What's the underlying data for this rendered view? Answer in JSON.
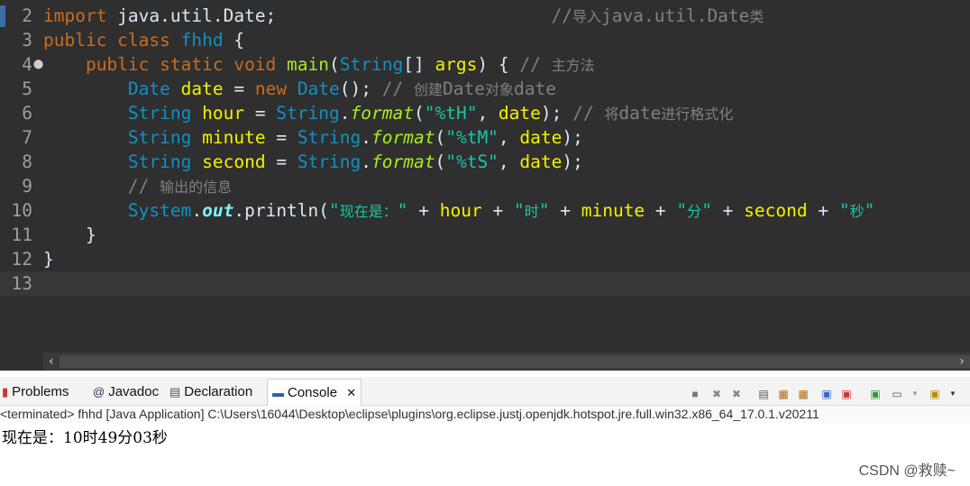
{
  "editor": {
    "lines": [
      {
        "n": "2",
        "fold": "",
        "current": false,
        "tokens": [
          {
            "t": "kw",
            "v": "import"
          },
          {
            "t": "",
            "v": " java.util.Date;                          "
          },
          {
            "t": "cm",
            "v": "//导入java.util.Date类"
          }
        ]
      },
      {
        "n": "3",
        "fold": "",
        "current": false,
        "tokens": [
          {
            "t": "kw",
            "v": "public class "
          },
          {
            "t": "typ",
            "v": "fhhd"
          },
          {
            "t": "",
            "v": " {"
          }
        ]
      },
      {
        "n": "4",
        "fold": "⬤",
        "current": false,
        "tokens": [
          {
            "t": "",
            "v": "    "
          },
          {
            "t": "kw",
            "v": "public static void "
          },
          {
            "t": "meth",
            "v": "main"
          },
          {
            "t": "",
            "v": "("
          },
          {
            "t": "typ",
            "v": "String"
          },
          {
            "t": "",
            "v": "[] "
          },
          {
            "t": "var",
            "v": "args"
          },
          {
            "t": "",
            "v": ") { "
          },
          {
            "t": "cm",
            "v": "// 主方法"
          }
        ]
      },
      {
        "n": "5",
        "fold": "",
        "current": false,
        "tokens": [
          {
            "t": "",
            "v": "        "
          },
          {
            "t": "typ",
            "v": "Date"
          },
          {
            "t": "",
            "v": " "
          },
          {
            "t": "var",
            "v": "date"
          },
          {
            "t": "",
            "v": " = "
          },
          {
            "t": "kw",
            "v": "new "
          },
          {
            "t": "typ",
            "v": "Date"
          },
          {
            "t": "",
            "v": "(); "
          },
          {
            "t": "cm",
            "v": "// 创建Date对象date"
          }
        ]
      },
      {
        "n": "6",
        "fold": "",
        "current": false,
        "tokens": [
          {
            "t": "",
            "v": "        "
          },
          {
            "t": "typ",
            "v": "String"
          },
          {
            "t": "",
            "v": " "
          },
          {
            "t": "var",
            "v": "hour"
          },
          {
            "t": "",
            "v": " = "
          },
          {
            "t": "typ",
            "v": "String"
          },
          {
            "t": "",
            "v": "."
          },
          {
            "t": "ital",
            "v": "format"
          },
          {
            "t": "",
            "v": "("
          },
          {
            "t": "str",
            "v": "\"%tH\""
          },
          {
            "t": "",
            "v": ", "
          },
          {
            "t": "var",
            "v": "date"
          },
          {
            "t": "",
            "v": "); "
          },
          {
            "t": "cm",
            "v": "// 将date进行格式化"
          }
        ]
      },
      {
        "n": "7",
        "fold": "",
        "current": false,
        "tokens": [
          {
            "t": "",
            "v": "        "
          },
          {
            "t": "typ",
            "v": "String"
          },
          {
            "t": "",
            "v": " "
          },
          {
            "t": "var",
            "v": "minute"
          },
          {
            "t": "",
            "v": " = "
          },
          {
            "t": "typ",
            "v": "String"
          },
          {
            "t": "",
            "v": "."
          },
          {
            "t": "ital",
            "v": "format"
          },
          {
            "t": "",
            "v": "("
          },
          {
            "t": "str",
            "v": "\"%tM\""
          },
          {
            "t": "",
            "v": ", "
          },
          {
            "t": "var",
            "v": "date"
          },
          {
            "t": "",
            "v": ");"
          }
        ]
      },
      {
        "n": "8",
        "fold": "",
        "current": false,
        "tokens": [
          {
            "t": "",
            "v": "        "
          },
          {
            "t": "typ",
            "v": "String"
          },
          {
            "t": "",
            "v": " "
          },
          {
            "t": "var",
            "v": "second"
          },
          {
            "t": "",
            "v": " = "
          },
          {
            "t": "typ",
            "v": "String"
          },
          {
            "t": "",
            "v": "."
          },
          {
            "t": "ital",
            "v": "format"
          },
          {
            "t": "",
            "v": "("
          },
          {
            "t": "str",
            "v": "\"%tS\""
          },
          {
            "t": "",
            "v": ", "
          },
          {
            "t": "var",
            "v": "date"
          },
          {
            "t": "",
            "v": ");"
          }
        ]
      },
      {
        "n": "9",
        "fold": "",
        "current": false,
        "tokens": [
          {
            "t": "",
            "v": "        "
          },
          {
            "t": "cm",
            "v": "// 输出的信息"
          }
        ]
      },
      {
        "n": "10",
        "fold": "",
        "current": false,
        "tokens": [
          {
            "t": "",
            "v": "        "
          },
          {
            "t": "typ",
            "v": "System"
          },
          {
            "t": "",
            "v": "."
          },
          {
            "t": "stat",
            "v": "out"
          },
          {
            "t": "",
            "v": ".println("
          },
          {
            "t": "str",
            "v": "\"现在是：\""
          },
          {
            "t": "",
            "v": " + "
          },
          {
            "t": "var",
            "v": "hour"
          },
          {
            "t": "",
            "v": " + "
          },
          {
            "t": "str",
            "v": "\"时\""
          },
          {
            "t": "",
            "v": " + "
          },
          {
            "t": "var",
            "v": "minute"
          },
          {
            "t": "",
            "v": " + "
          },
          {
            "t": "str",
            "v": "\"分\""
          },
          {
            "t": "",
            "v": " + "
          },
          {
            "t": "var",
            "v": "second"
          },
          {
            "t": "",
            "v": " + "
          },
          {
            "t": "str",
            "v": "\"秒\""
          }
        ]
      },
      {
        "n": "11",
        "fold": "",
        "current": false,
        "tokens": [
          {
            "t": "",
            "v": "    }"
          }
        ]
      },
      {
        "n": "12",
        "fold": "",
        "current": false,
        "tokens": [
          {
            "t": "",
            "v": "}"
          }
        ]
      },
      {
        "n": "13",
        "fold": "",
        "current": true,
        "tokens": []
      }
    ]
  },
  "scrollbar": {
    "left_arrow": "‹",
    "right_arrow": "›"
  },
  "tabs": {
    "problems": {
      "label": "Problems",
      "icon": "problems-icon"
    },
    "javadoc": {
      "label": "Javadoc",
      "icon": "javadoc-icon"
    },
    "declaration": {
      "label": "Declaration",
      "icon": "declaration-icon"
    },
    "console": {
      "label": "Console",
      "icon": "console-icon",
      "close": "✕"
    }
  },
  "console": {
    "description": "<terminated> fhhd [Java Application] C:\\Users\\16044\\Desktop\\eclipse\\plugins\\org.eclipse.justj.openjdk.hotspot.jre.full.win32.x86_64_17.0.1.v20211",
    "output": "现在是：10时49分03秒"
  },
  "watermark": "CSDN @救赎~",
  "colors": {
    "accent": "#3a6ea5",
    "editor_bg": "#2f2f2f",
    "keyword": "#cc6c1d",
    "type": "#1290c3",
    "variable": "#f2f200",
    "string": "#17c6a3",
    "comment": "#808080"
  }
}
